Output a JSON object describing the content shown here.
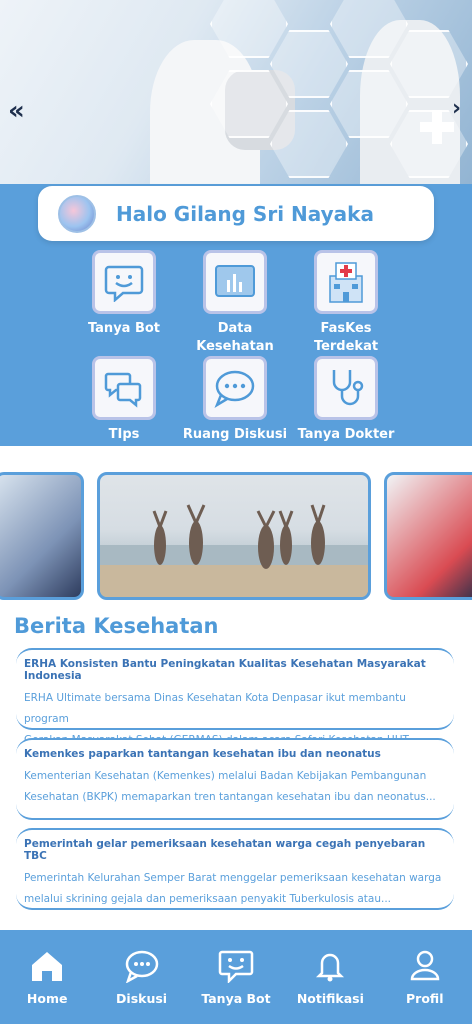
{
  "greeting": "Halo Gilang Sri Nayaka",
  "menu": [
    {
      "label": "Tanya Bot",
      "icon": "chat-bot-icon"
    },
    {
      "label": "Data Kesehatan Anak",
      "icon": "bar-chart-icon"
    },
    {
      "label": "FasKes Terdekat",
      "icon": "hospital-icon"
    },
    {
      "label": "TIps Kesehatan",
      "icon": "chat-bubbles-icon"
    },
    {
      "label": "Ruang Diskusi",
      "icon": "discussion-icon"
    },
    {
      "label": "Tanya Dokter",
      "icon": "stethoscope-icon"
    }
  ],
  "news_section_title": "Berita Kesehatan",
  "news": [
    {
      "title": "ERHA Konsisten Bantu Peningkatan Kualitas Kesehatan Masyarakat Indonesia",
      "body1": "ERHA Ultimate bersama Dinas Kesehatan Kota Denpasar ikut membantu program",
      "body2": "Gerakan Masyarakat Sehat (GERMAS) dalam acara Safari Kesehatan HUT..."
    },
    {
      "title": "Kemenkes paparkan tantangan kesehatan ibu dan neonatus",
      "body1": "Kementerian Kesehatan (Kemenkes) melalui Badan Kebijakan Pembangunan",
      "body2": "Kesehatan (BKPK) memaparkan tren tantangan kesehatan ibu dan neonatus..."
    },
    {
      "title": "Pemerintah gelar pemeriksaan kesehatan warga cegah penyebaran TBC",
      "body1": "Pemerintah Kelurahan Semper Barat menggelar pemeriksaan kesehatan warga",
      "body2": "melalui skrining gejala dan pemeriksaan penyakit Tuberkulosis atau..."
    }
  ],
  "nav": [
    {
      "label": "Home",
      "icon": "home-icon"
    },
    {
      "label": "Diskusi",
      "icon": "chat-icon"
    },
    {
      "label": "Tanya Bot",
      "icon": "bot-icon"
    },
    {
      "label": "Notifikasi",
      "icon": "bell-icon"
    },
    {
      "label": "Profil",
      "icon": "user-icon"
    }
  ],
  "colors": {
    "primary": "#5a9fdb",
    "accent": "#4f9ad8",
    "dark": "#1e2f4d"
  }
}
